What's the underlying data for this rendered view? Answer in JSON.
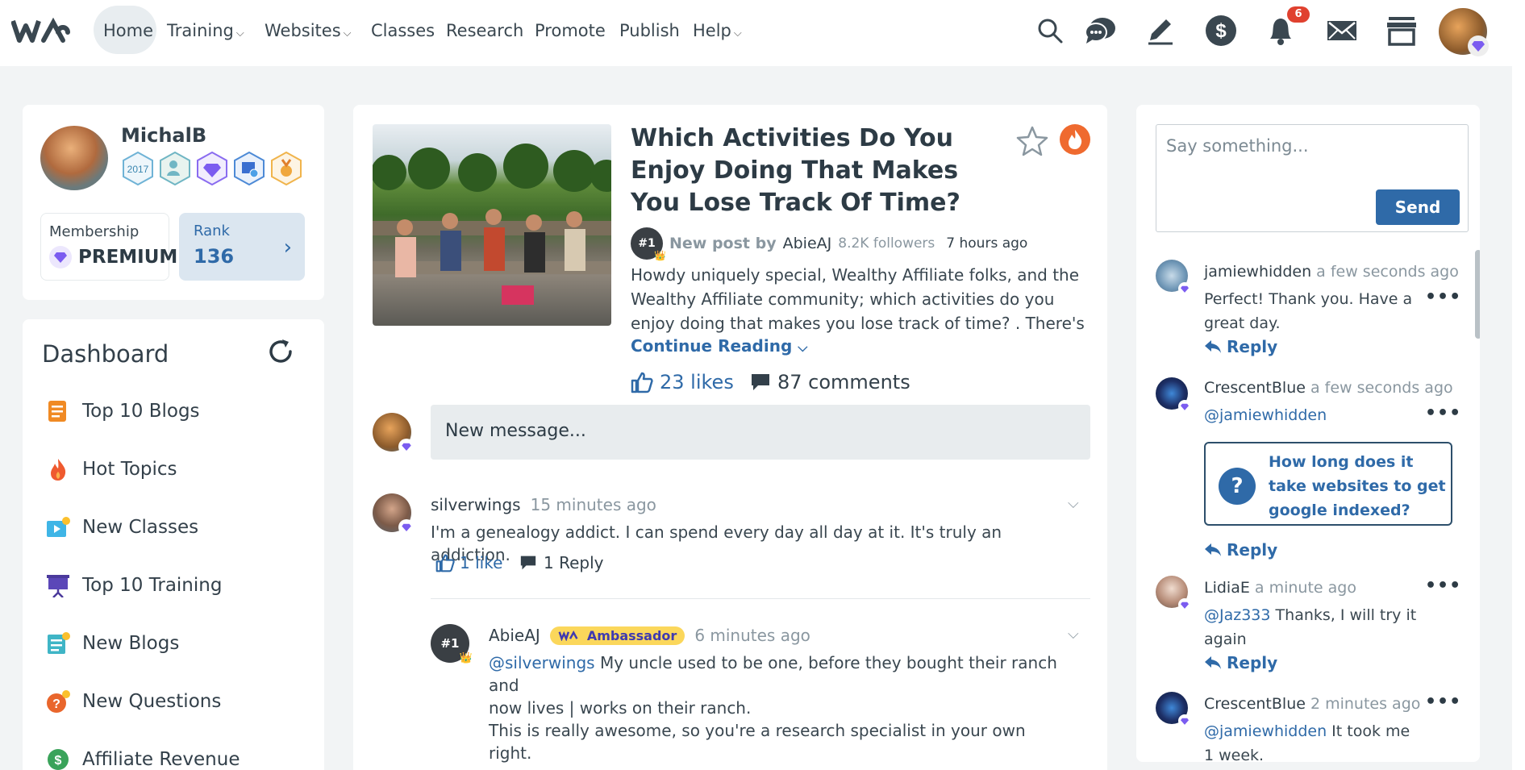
{
  "nav": {
    "items": [
      {
        "label": "Home"
      },
      {
        "label": "Training"
      },
      {
        "label": "Websites"
      },
      {
        "label": "Classes"
      },
      {
        "label": "Research"
      },
      {
        "label": "Promote"
      },
      {
        "label": "Publish"
      },
      {
        "label": "Help"
      }
    ],
    "notification_count": "6"
  },
  "profile": {
    "name": "MichalB",
    "badge_year": "2017",
    "membership_label": "Membership",
    "membership_value": "PREMIUM",
    "rank_label": "Rank",
    "rank_value": "136"
  },
  "dashboard": {
    "title": "Dashboard",
    "items": [
      {
        "label": "Top 10 Blogs"
      },
      {
        "label": "Hot Topics"
      },
      {
        "label": "New Classes"
      },
      {
        "label": "Top 10 Training"
      },
      {
        "label": "New Blogs"
      },
      {
        "label": "New Questions"
      },
      {
        "label": "Affiliate Revenue"
      }
    ]
  },
  "post": {
    "title": "Which Activities Do You Enjoy Doing That Makes You Lose Track Of Time?",
    "meta_prefix": "New post by",
    "author": "AbieAJ",
    "followers": "8.2K followers",
    "time": "7 hours ago",
    "body": "Howdy uniquely special, Wealthy Affiliate folks, and the Wealthy Affiliate community; which activities do you enjoy doing that makes you lose track of time? . There's no single ans",
    "continue_label": "Continue Reading",
    "likes": "23 likes",
    "comments": "87 comments",
    "new_message_placeholder": "New message..."
  },
  "comments": [
    {
      "name": "silverwings",
      "time": "15 minutes ago",
      "text": "I'm a genealogy addict. I can spend every day all day at it. It's truly an addiction.",
      "likes": "1 like",
      "replies": "1 Reply"
    },
    {
      "name": "AbieAJ",
      "badge": "Ambassador",
      "time": "6 minutes ago",
      "mention": "@silverwings",
      "text_line1": "My uncle used to be one, before they bought their ranch and",
      "text_line2": "now lives | works on their ranch.",
      "text_para2": "This is really awesome, so you're a research specialist in your own right."
    }
  ],
  "chat": {
    "placeholder": "Say something...",
    "send_label": "Send",
    "reply_label": "Reply",
    "messages": [
      {
        "name": "jamiewhidden",
        "time": "a few seconds ago",
        "text": "Perfect! Thank you. Have a great day."
      },
      {
        "name": "CrescentBlue",
        "time": "a few seconds ago",
        "mention": "@jamiewhidden",
        "question": "How long does it take websites to get google indexed?"
      },
      {
        "name": "LidiaE",
        "time": "a minute ago",
        "mention": "@Jaz333",
        "text": "Thanks, I will try it again"
      },
      {
        "name": "CrescentBlue",
        "time": "2 minutes ago",
        "mention": "@jamiewhidden",
        "text": "It took me 1 week."
      }
    ]
  },
  "colors": {
    "accent": "#2f6aa8",
    "premium": "#7b5cf0",
    "badge_red": "#e0412f",
    "fire": "#ef6a2f"
  }
}
